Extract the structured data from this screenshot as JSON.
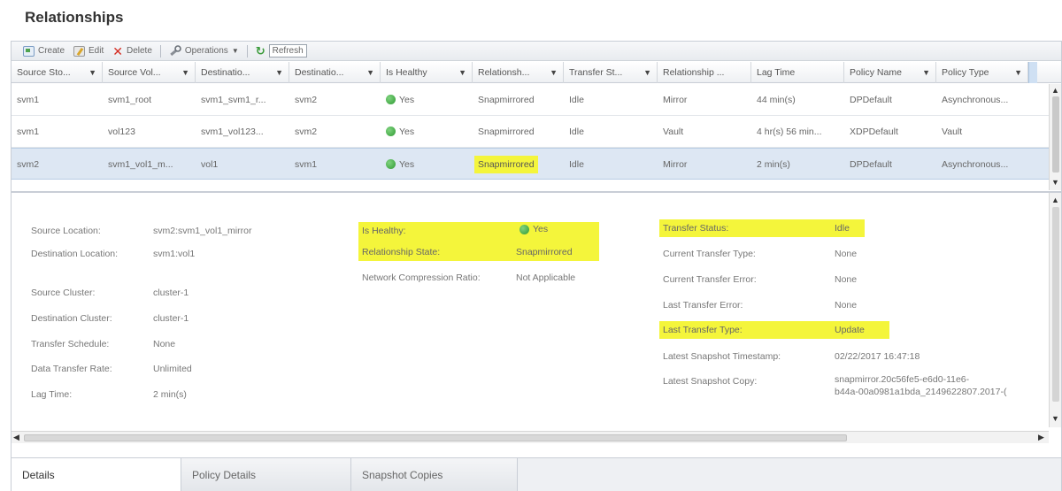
{
  "page": {
    "title": "Relationships"
  },
  "toolbar": {
    "create": "Create",
    "edit": "Edit",
    "delete": "Delete",
    "operations": "Operations",
    "refresh": "Refresh"
  },
  "grid": {
    "columns": [
      "Source Sto...",
      "Source Vol...",
      "Destinatio...",
      "Destinatio...",
      "Is Healthy",
      "Relationsh...",
      "Transfer St...",
      "Relationship ...",
      "Lag Time",
      "Policy Name",
      "Policy Type"
    ],
    "rows": [
      [
        "svm1",
        "svm1_root",
        "svm1_svm1_r...",
        "svm2",
        "Yes",
        "Snapmirrored",
        "Idle",
        "Mirror",
        "44 min(s)",
        "DPDefault",
        "Asynchronous..."
      ],
      [
        "svm1",
        "vol123",
        "svm1_vol123...",
        "svm2",
        "Yes",
        "Snapmirrored",
        "Idle",
        "Vault",
        "4 hr(s) 56 min...",
        "XDPDefault",
        "Vault"
      ],
      [
        "svm2",
        "svm1_vol1_m...",
        "vol1",
        "svm1",
        "Yes",
        "Snapmirrored",
        "Idle",
        "Mirror",
        "2 min(s)",
        "DPDefault",
        "Asynchronous..."
      ]
    ],
    "selected_row": 2,
    "healthy_color": "#2f9a33"
  },
  "details": {
    "left": [
      {
        "label": "Source Location:",
        "value": "svm2:svm1_vol1_mirror"
      },
      {
        "label": "Destination Location:",
        "value": "svm1:vol1"
      },
      {
        "label": "Source Cluster:",
        "value": "cluster-1"
      },
      {
        "label": "Destination Cluster:",
        "value": "cluster-1"
      },
      {
        "label": "Transfer Schedule:",
        "value": "None"
      },
      {
        "label": "Data Transfer Rate:",
        "value": "Unlimited"
      },
      {
        "label": "Lag Time:",
        "value": "2 min(s)"
      }
    ],
    "middle": [
      {
        "label": "Is Healthy:",
        "value": "Yes"
      },
      {
        "label": "Relationship State:",
        "value": "Snapmirrored"
      },
      {
        "label": "Network Compression Ratio:",
        "value": "Not Applicable"
      }
    ],
    "right": [
      {
        "label": "Transfer Status:",
        "value": "Idle"
      },
      {
        "label": "Current Transfer Type:",
        "value": "None"
      },
      {
        "label": "Current Transfer Error:",
        "value": "None"
      },
      {
        "label": "Last Transfer Error:",
        "value": "None"
      },
      {
        "label": "Last Transfer Type:",
        "value": "Update"
      },
      {
        "label": "Latest Snapshot Timestamp:",
        "value": "02/22/2017 16:47:18"
      },
      {
        "label": "Latest Snapshot Copy:",
        "value": "snapmirror.20c56fe5-e6d0-11e6-",
        "value2": "b44a-00a0981a1bda_2149622807.2017-("
      }
    ],
    "highlight_color": "#f4f53b"
  },
  "tabs": [
    "Details",
    "Policy Details",
    "Snapshot Copies"
  ]
}
